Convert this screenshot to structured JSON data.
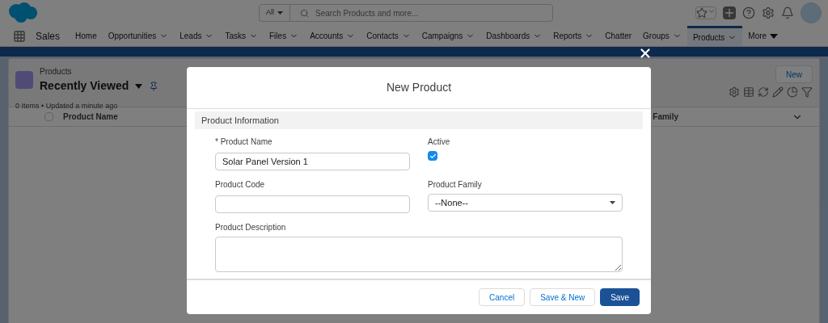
{
  "header": {
    "search_scope": "All",
    "search_placeholder": "Search Products and more..."
  },
  "nav": {
    "app_name": "Sales",
    "items": [
      {
        "label": "Home",
        "kind": "plain",
        "selected": false
      },
      {
        "label": "Opportunities",
        "kind": "menu",
        "selected": false
      },
      {
        "label": "Leads",
        "kind": "menu",
        "selected": false
      },
      {
        "label": "Tasks",
        "kind": "menu",
        "selected": false
      },
      {
        "label": "Files",
        "kind": "menu",
        "selected": false
      },
      {
        "label": "Accounts",
        "kind": "menu",
        "selected": false
      },
      {
        "label": "Contacts",
        "kind": "menu",
        "selected": false
      },
      {
        "label": "Campaigns",
        "kind": "menu",
        "selected": false
      },
      {
        "label": "Dashboards",
        "kind": "menu",
        "selected": false
      },
      {
        "label": "Reports",
        "kind": "menu",
        "selected": false
      },
      {
        "label": "Chatter",
        "kind": "plain",
        "selected": false
      },
      {
        "label": "Groups",
        "kind": "menu",
        "selected": false
      },
      {
        "label": "Products",
        "kind": "menu",
        "selected": true
      },
      {
        "label": "More",
        "kind": "more",
        "selected": false
      }
    ]
  },
  "list_view": {
    "object": "Products",
    "view_name": "Recently Viewed",
    "status": "0 Items • Updated a minute ago",
    "new_button": "New",
    "select_all_checked": false,
    "columns": [
      "Product Name",
      "Family"
    ]
  },
  "modal": {
    "title": "New Product",
    "section": "Product Information",
    "fields": [
      {
        "label": "* Product Name",
        "kind": "text",
        "value": "Solar Panel Version 1"
      },
      {
        "label": "Active",
        "kind": "checkbox",
        "checked": true
      },
      {
        "label": "Product Code",
        "kind": "text"
      },
      {
        "label": "Product Family",
        "kind": "select",
        "value": "--None--"
      },
      {
        "label": "Product Description",
        "kind": "textarea"
      }
    ],
    "buttons": [
      {
        "label": "Cancel",
        "kind": "neutral"
      },
      {
        "label": "Save & New",
        "kind": "neutral"
      },
      {
        "label": "Save",
        "kind": "brand"
      }
    ]
  }
}
